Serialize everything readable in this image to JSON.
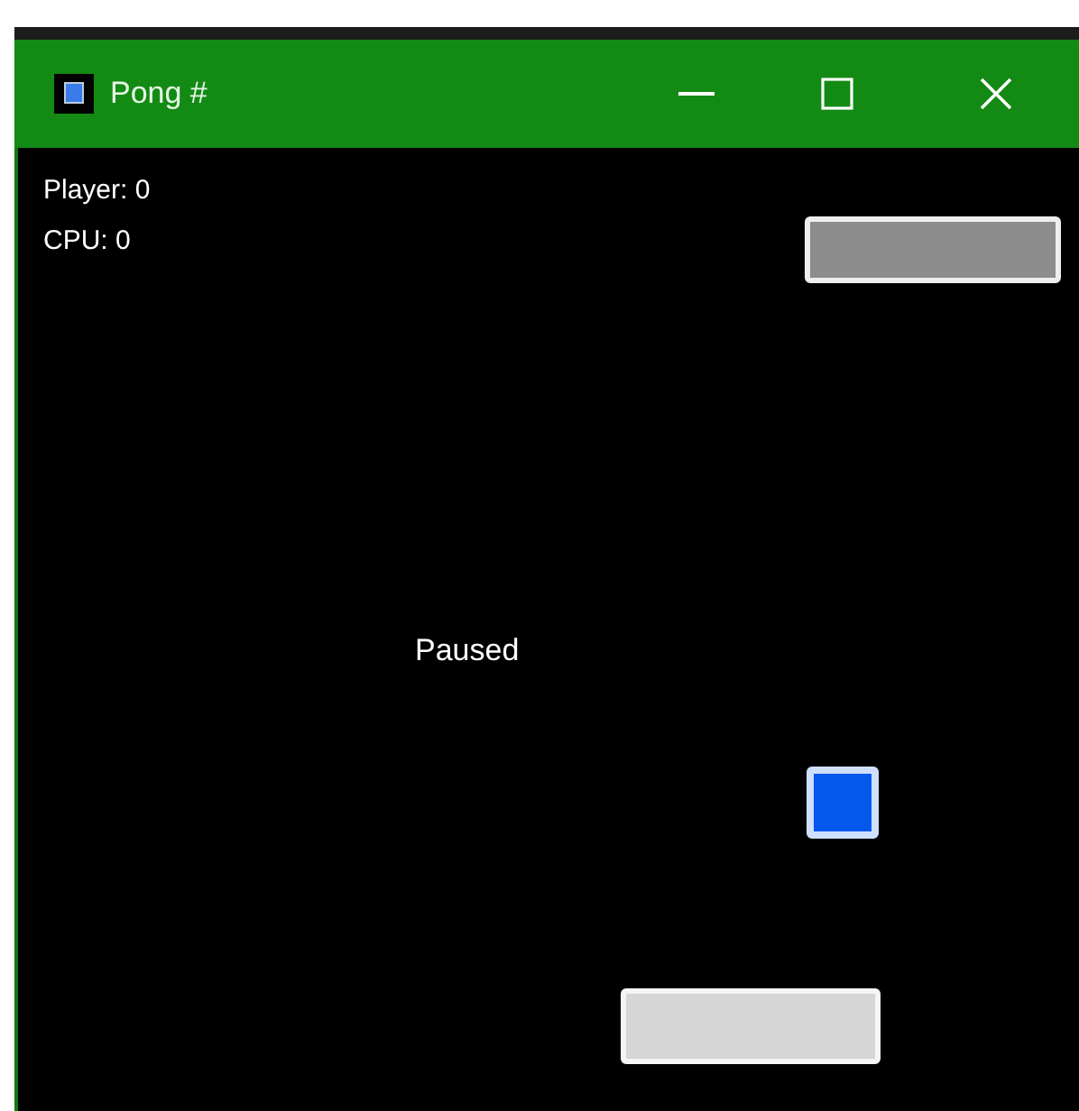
{
  "window": {
    "title": "Pong #"
  },
  "scores": [
    {
      "text": "Player: 0"
    },
    {
      "text": "CPU: 0"
    }
  ],
  "status": "Paused"
}
